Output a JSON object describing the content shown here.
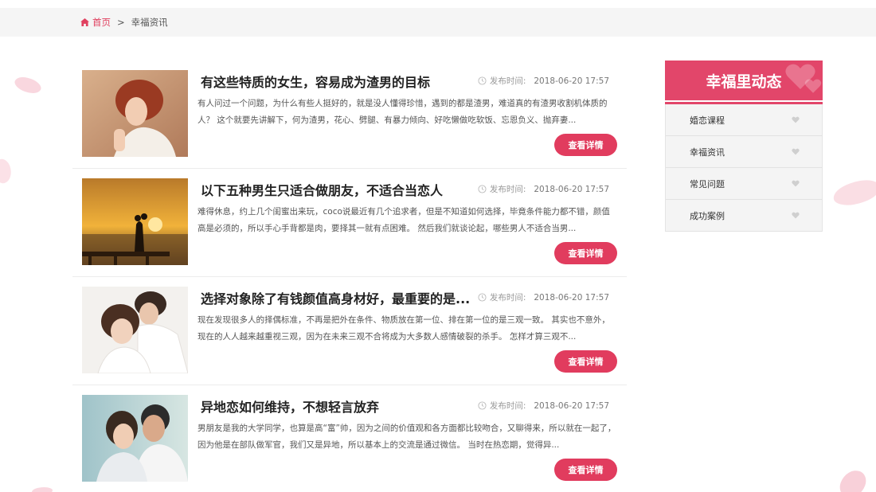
{
  "breadcrumb": {
    "home": "首页",
    "separator": ">",
    "current": "幸福资讯"
  },
  "articles": [
    {
      "title": "有这些特质的女生，容易成为渣男的目标",
      "time_label": "发布时间:",
      "time_value": "2018-06-20 17:57",
      "excerpt": "有人问过一个问题，为什么有些人挺好的，就是没人懂得珍惜，遇到的都是渣男，难道真的有渣男收割机体质的人？ 这个就要先讲解下，何为渣男，花心、劈腿、有暴力倾向、好吃懒做吃软饭、忘恩负义、抛弃妻...",
      "button": "查看详情"
    },
    {
      "title": "以下五种男生只适合做朋友，不适合当恋人",
      "time_label": "发布时间:",
      "time_value": "2018-06-20 17:57",
      "excerpt": "难得休息，约上几个闺蜜出来玩，coco说最近有几个追求者，但是不知道如何选择，毕竟条件能力都不错，颜值高是必须的，所以手心手背都是肉，要择其一就有点困难。 然后我们就谈论起，哪些男人不适合当男...",
      "button": "查看详情"
    },
    {
      "title": "选择对象除了有钱颜值高身材好，最重要的是...",
      "time_label": "发布时间:",
      "time_value": "2018-06-20 17:57",
      "excerpt": "现在发现很多人的择偶标准，不再是把外在条件、物质放在第一位、排在第一位的是三观一致。 其实也不意外，现在的人人越来越重视三观，因为在未来三观不合将成为大多数人感情破裂的杀手。 怎样才算三观不...",
      "button": "查看详情"
    },
    {
      "title": "异地恋如何维持，不想轻言放弃",
      "time_label": "发布时间:",
      "time_value": "2018-06-20 17:57",
      "excerpt": "男朋友是我的大学同学，也算是高“富”帅，因为之间的价值观和各方面都比较吻合，又聊得来，所以就在一起了，因为他是在部队做军官，我们又是异地，所以基本上的交流是通过微信。 当时在热恋期，觉得异...",
      "button": "查看详情"
    }
  ],
  "sidebar": {
    "title": "幸福里动态",
    "items": [
      {
        "label": "婚恋课程"
      },
      {
        "label": "幸福资讯"
      },
      {
        "label": "常见问题"
      },
      {
        "label": "成功案例"
      }
    ]
  },
  "colors": {
    "accent": "#e13c5e",
    "sidebar_head": "#e2466a",
    "breadcrumb_bg": "#f5f5f5"
  }
}
